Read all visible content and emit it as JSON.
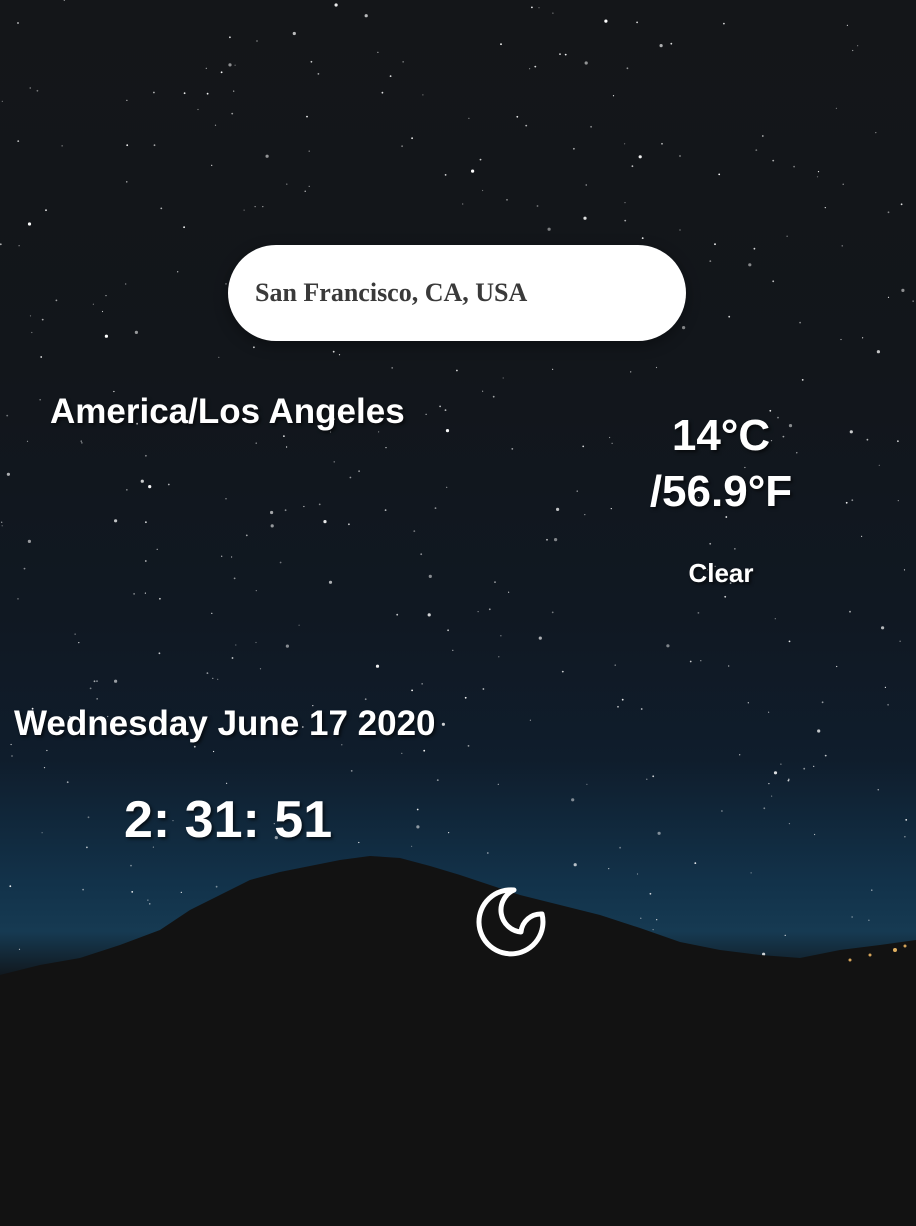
{
  "search": {
    "value": "San Francisco, CA, USA"
  },
  "location": {
    "timezone": "America/Los Angeles"
  },
  "weather": {
    "temp_c": "14°C",
    "temp_f": "/56.9°F",
    "condition": "Clear",
    "icon": "moon-icon"
  },
  "datetime": {
    "date": "Wednesday June 17 2020",
    "time": "2: 31: 51"
  },
  "colors": {
    "text": "#ffffff",
    "search_bg": "#ffffff",
    "search_text": "#3a3a3a"
  }
}
